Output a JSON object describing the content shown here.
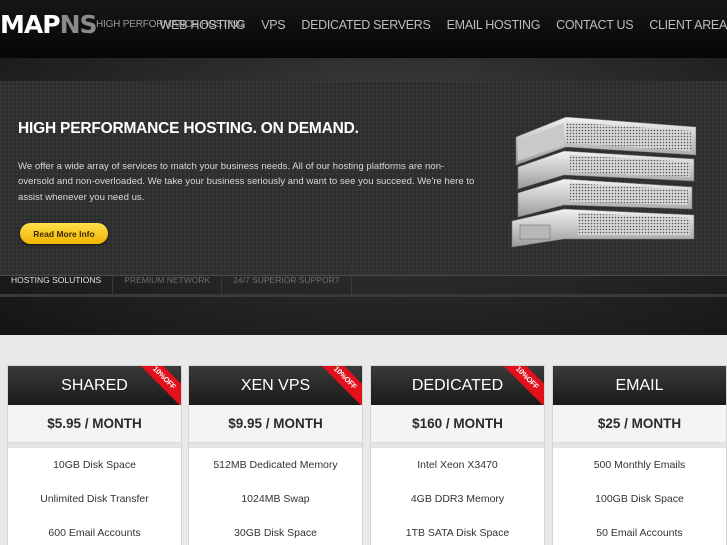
{
  "header": {
    "logo_main": "MAP",
    "logo_accent": "NS",
    "tagline": "HIGH PERFORMANCE HOSTING",
    "nav": [
      "WEB HOSTING",
      "VPS",
      "DEDICATED SERVERS",
      "EMAIL HOSTING",
      "CONTACT US",
      "CLIENT AREA"
    ]
  },
  "hero": {
    "title": "HIGH PERFORMANCE HOSTING. ON DEMAND.",
    "text": "We offer a wide array of services to match your business needs. All of our hosting platforms are non-oversold and non-overloaded. We take your business seriously and want to see you succeed. We're here to assist whenever you need us.",
    "button": "Read More Info",
    "tabs": [
      "HOSTING SOLUTIONS",
      "PREMIUM NETWORK",
      "24/7 SUPERIOR SUPPORT"
    ],
    "active_tab": "HOSTING SOLUTIONS",
    "image_icon": "server-rack-icon"
  },
  "plans": [
    {
      "name": "SHARED",
      "price": "$5.95 / MONTH",
      "ribbon": "10%OFF",
      "features": [
        "10GB Disk Space",
        "Unlimited Disk Transfer",
        "600 Email Accounts"
      ]
    },
    {
      "name": "XEN VPS",
      "price": "$9.95 / MONTH",
      "ribbon": "10%OFF",
      "features": [
        "512MB Dedicated Memory",
        "1024MB Swap",
        "30GB Disk Space"
      ]
    },
    {
      "name": "DEDICATED",
      "price": "$160 / MONTH",
      "ribbon": "10%OFF",
      "features": [
        "Intel Xeon X3470",
        "4GB DDR3 Memory",
        "1TB SATA Disk Space"
      ]
    },
    {
      "name": "EMAIL",
      "price": "$25 / MONTH",
      "ribbon": "",
      "features": [
        "500 Monthly Emails",
        "100GB Disk Space",
        "50 Email Accounts"
      ]
    }
  ],
  "colors": {
    "button_yellow": "#f0b300",
    "ribbon_red": "#e0111a",
    "header_bg": "#0d0d0d"
  }
}
